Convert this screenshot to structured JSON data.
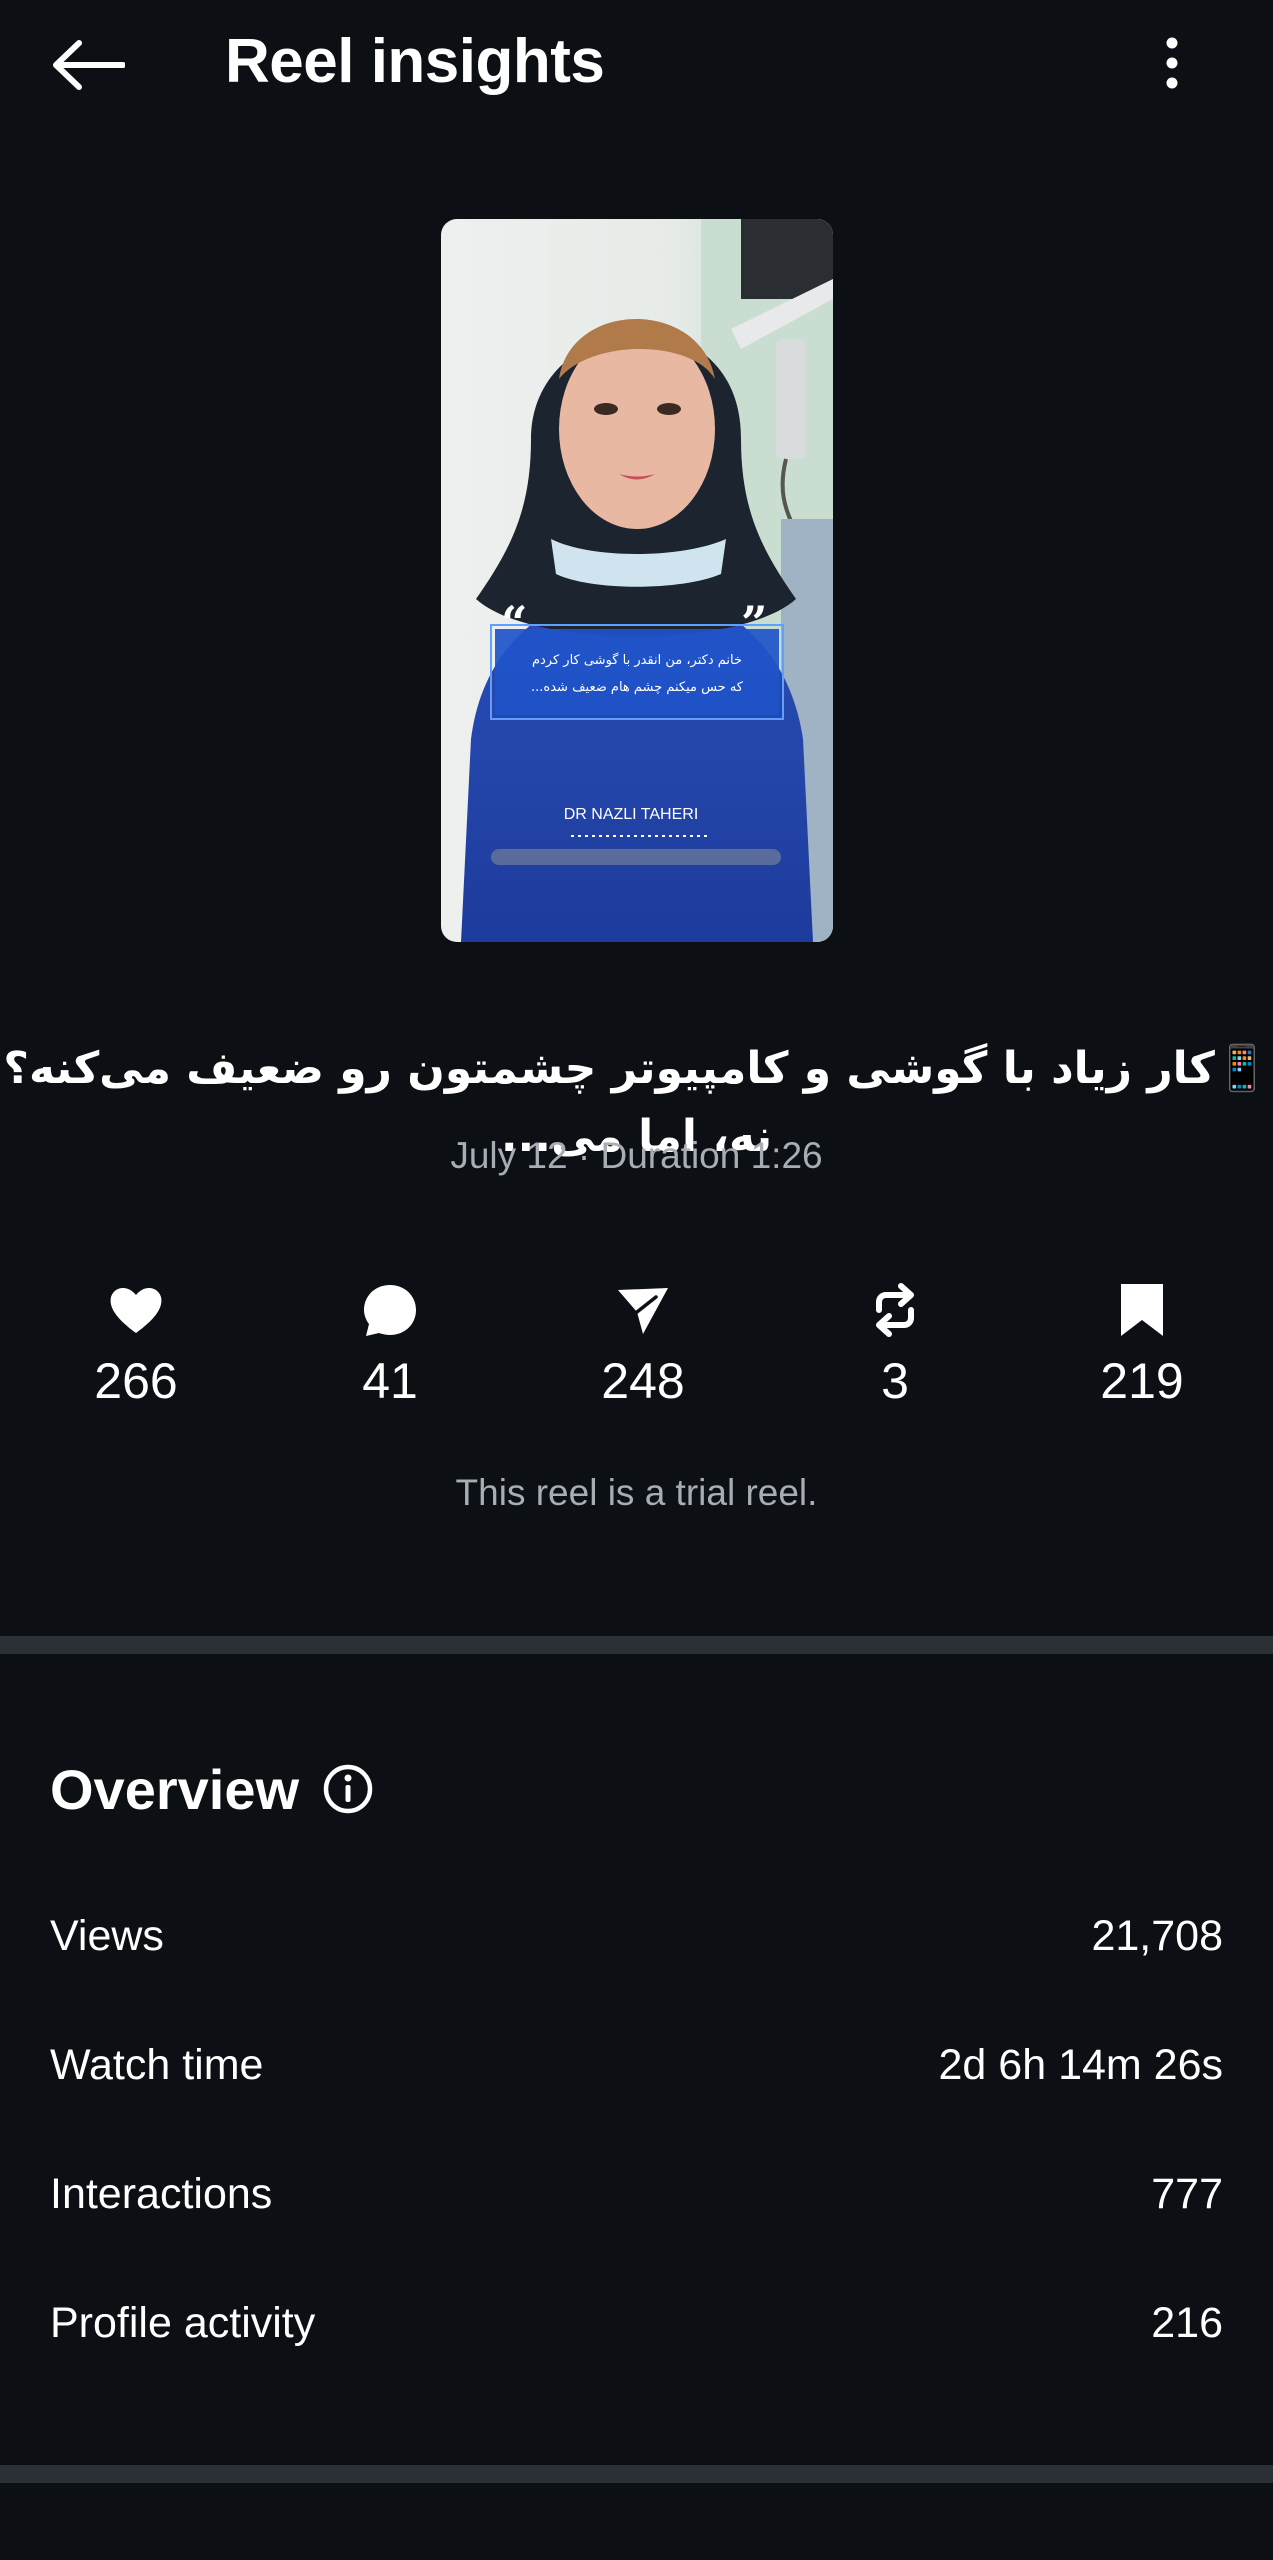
{
  "header": {
    "title": "Reel insights",
    "back_icon": "arrow-left-icon",
    "more_icon": "more-vertical-icon"
  },
  "reel": {
    "thumbnail": {
      "quote_text_line1": "خانم دکتر، من انقدر با گوشی کار کردم",
      "quote_text_line2": "که حس میکنم چشم هام ضعیف شده...",
      "watermark": "DR NAZLI TAHERI"
    },
    "caption": "📱کار زیاد با گوشی و کامپیوتر چشمتون رو ضعیف می‌کنه؟ نه، اما می...",
    "meta": "July 12 · Duration 1:26"
  },
  "stats": [
    {
      "icon": "heart-icon",
      "value": "266"
    },
    {
      "icon": "comment-icon",
      "value": "41"
    },
    {
      "icon": "share-icon",
      "value": "248"
    },
    {
      "icon": "repost-icon",
      "value": "3"
    },
    {
      "icon": "bookmark-icon",
      "value": "219"
    }
  ],
  "trial_note": "This reel is a trial reel.",
  "overview": {
    "title": "Overview",
    "info_icon": "info-icon",
    "rows": [
      {
        "label": "Views",
        "value": "21,708"
      },
      {
        "label": "Watch time",
        "value": "2d 6h 14m 26s"
      },
      {
        "label": "Interactions",
        "value": "777"
      },
      {
        "label": "Profile activity",
        "value": "216"
      }
    ]
  },
  "colors": {
    "background": "#0c0f14",
    "secondary_text": "#a8adb5",
    "divider": "#2b2f36",
    "text": "#ffffff"
  }
}
